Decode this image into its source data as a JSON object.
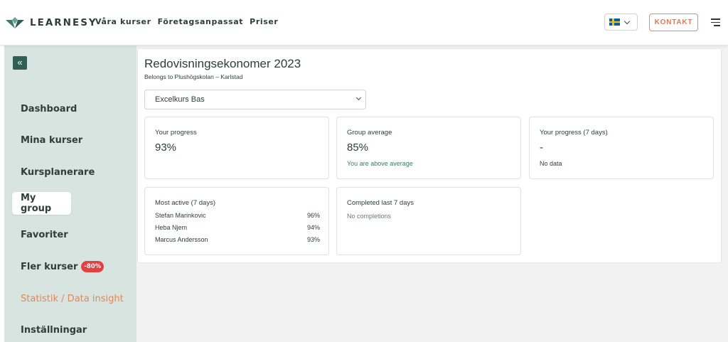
{
  "header": {
    "brand": "LEARNESY",
    "nav": [
      "Våra kurser",
      "Företagsanpassat",
      "Priser"
    ],
    "contact_label": "KONTAKT",
    "language": "sv-flag-icon"
  },
  "sidebar": {
    "collapse_icon": "«",
    "items": [
      {
        "label": "Dashboard"
      },
      {
        "label": "Mina kurser"
      },
      {
        "label": "Kursplanerare"
      },
      {
        "label": "My group"
      },
      {
        "label": "Favoriter"
      },
      {
        "label": "Fler kurser",
        "badge": "-80%"
      },
      {
        "label": "Statistik / Data insight"
      },
      {
        "label": "Inställningar"
      }
    ],
    "active_item": "My group"
  },
  "main": {
    "title": "Redovisningsekonomer 2023",
    "subtitle": "Belongs to Plushögskolan – Karlstad",
    "course_select": "Excelkurs Bas",
    "cards": {
      "progress": {
        "label": "Your progress",
        "value": "93%"
      },
      "group_average": {
        "label": "Group average",
        "value": "85%",
        "note": "You are above average"
      },
      "progress_7d": {
        "label": "Your progress (7 days)",
        "value": "-",
        "note": "No data"
      },
      "most_active": {
        "label": "Most active (7 days)",
        "rows": [
          {
            "name": "Stefan Marinkovic",
            "value": "96%"
          },
          {
            "name": "Heba Njem",
            "value": "94%"
          },
          {
            "name": "Marcus Andersson",
            "value": "93%"
          }
        ]
      },
      "completed": {
        "label": "Completed last 7 days",
        "note": "No completions"
      }
    }
  },
  "colors": {
    "sidebar_bg": "#d7e4e0",
    "accent_orange": "#e3865a",
    "brand_green": "#2f5e52",
    "badge_red": "#e3403f"
  }
}
